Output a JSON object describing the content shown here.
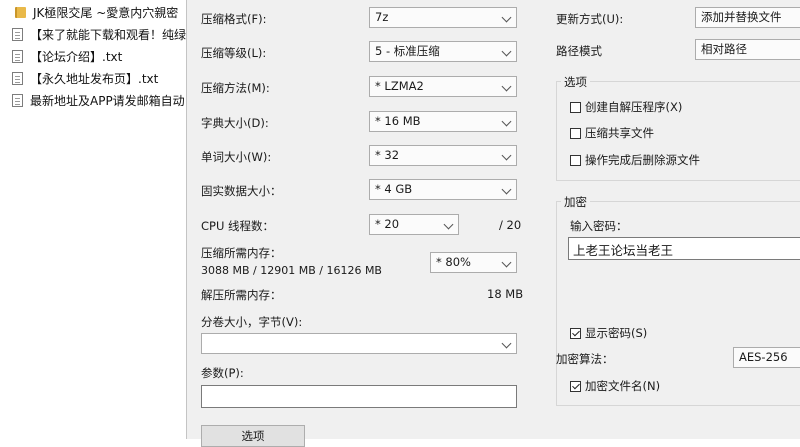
{
  "explorer": {
    "items": [
      {
        "icon": "folder-icon",
        "label": "JK極限交尾 ~愛意内穴親密"
      },
      {
        "icon": "text-file-icon",
        "label": "【来了就能下载和观看！纯绿"
      },
      {
        "icon": "text-file-icon",
        "label": "【论坛介绍】.txt"
      },
      {
        "icon": "text-file-icon",
        "label": "【永久地址发布页】.txt"
      },
      {
        "icon": "text-file-icon",
        "label": "最新地址及APP请发邮箱自动"
      }
    ]
  },
  "left": {
    "format_label": "压缩格式(F):",
    "format_value": "7z",
    "level_label": "压缩等级(L):",
    "level_value": "5 - 标准压缩",
    "method_label": "压缩方法(M):",
    "method_value": "* LZMA2",
    "dict_label": "字典大小(D):",
    "dict_value": "* 16 MB",
    "word_label": "单词大小(W):",
    "word_value": "* 32",
    "solid_label": "固实数据大小：",
    "solid_value": "* 4 GB",
    "cpu_label": "CPU 线程数：",
    "cpu_value": "* 20",
    "cpu_max": "/ 20",
    "mem_label": "压缩所需内存：",
    "mem_detail": "3088 MB / 12901 MB / 16126 MB",
    "mem_value": "* 80%",
    "decomp_label": "解压所需内存：",
    "decomp_value": "18 MB",
    "volume_label": "分卷大小，字节(V):",
    "volume_value": "",
    "params_label": "参数(P):",
    "params_value": "",
    "options_button": "选项"
  },
  "right": {
    "update_label": "更新方式(U):",
    "update_value": "添加并替换文件",
    "path_label": "路径模式",
    "path_value": "相对路径",
    "options_title": "选项",
    "opt_sfx": "创建自解压程序(X)",
    "opt_shared": "压缩共享文件",
    "opt_delete": "操作完成后删除源文件",
    "encrypt_title": "加密",
    "password_label": "输入密码：",
    "password_value": "上老王论坛当老王",
    "show_password": "显示密码(S)",
    "algo_label": "加密算法：",
    "algo_value": "AES-256",
    "encrypt_names": "加密文件名(N)"
  }
}
